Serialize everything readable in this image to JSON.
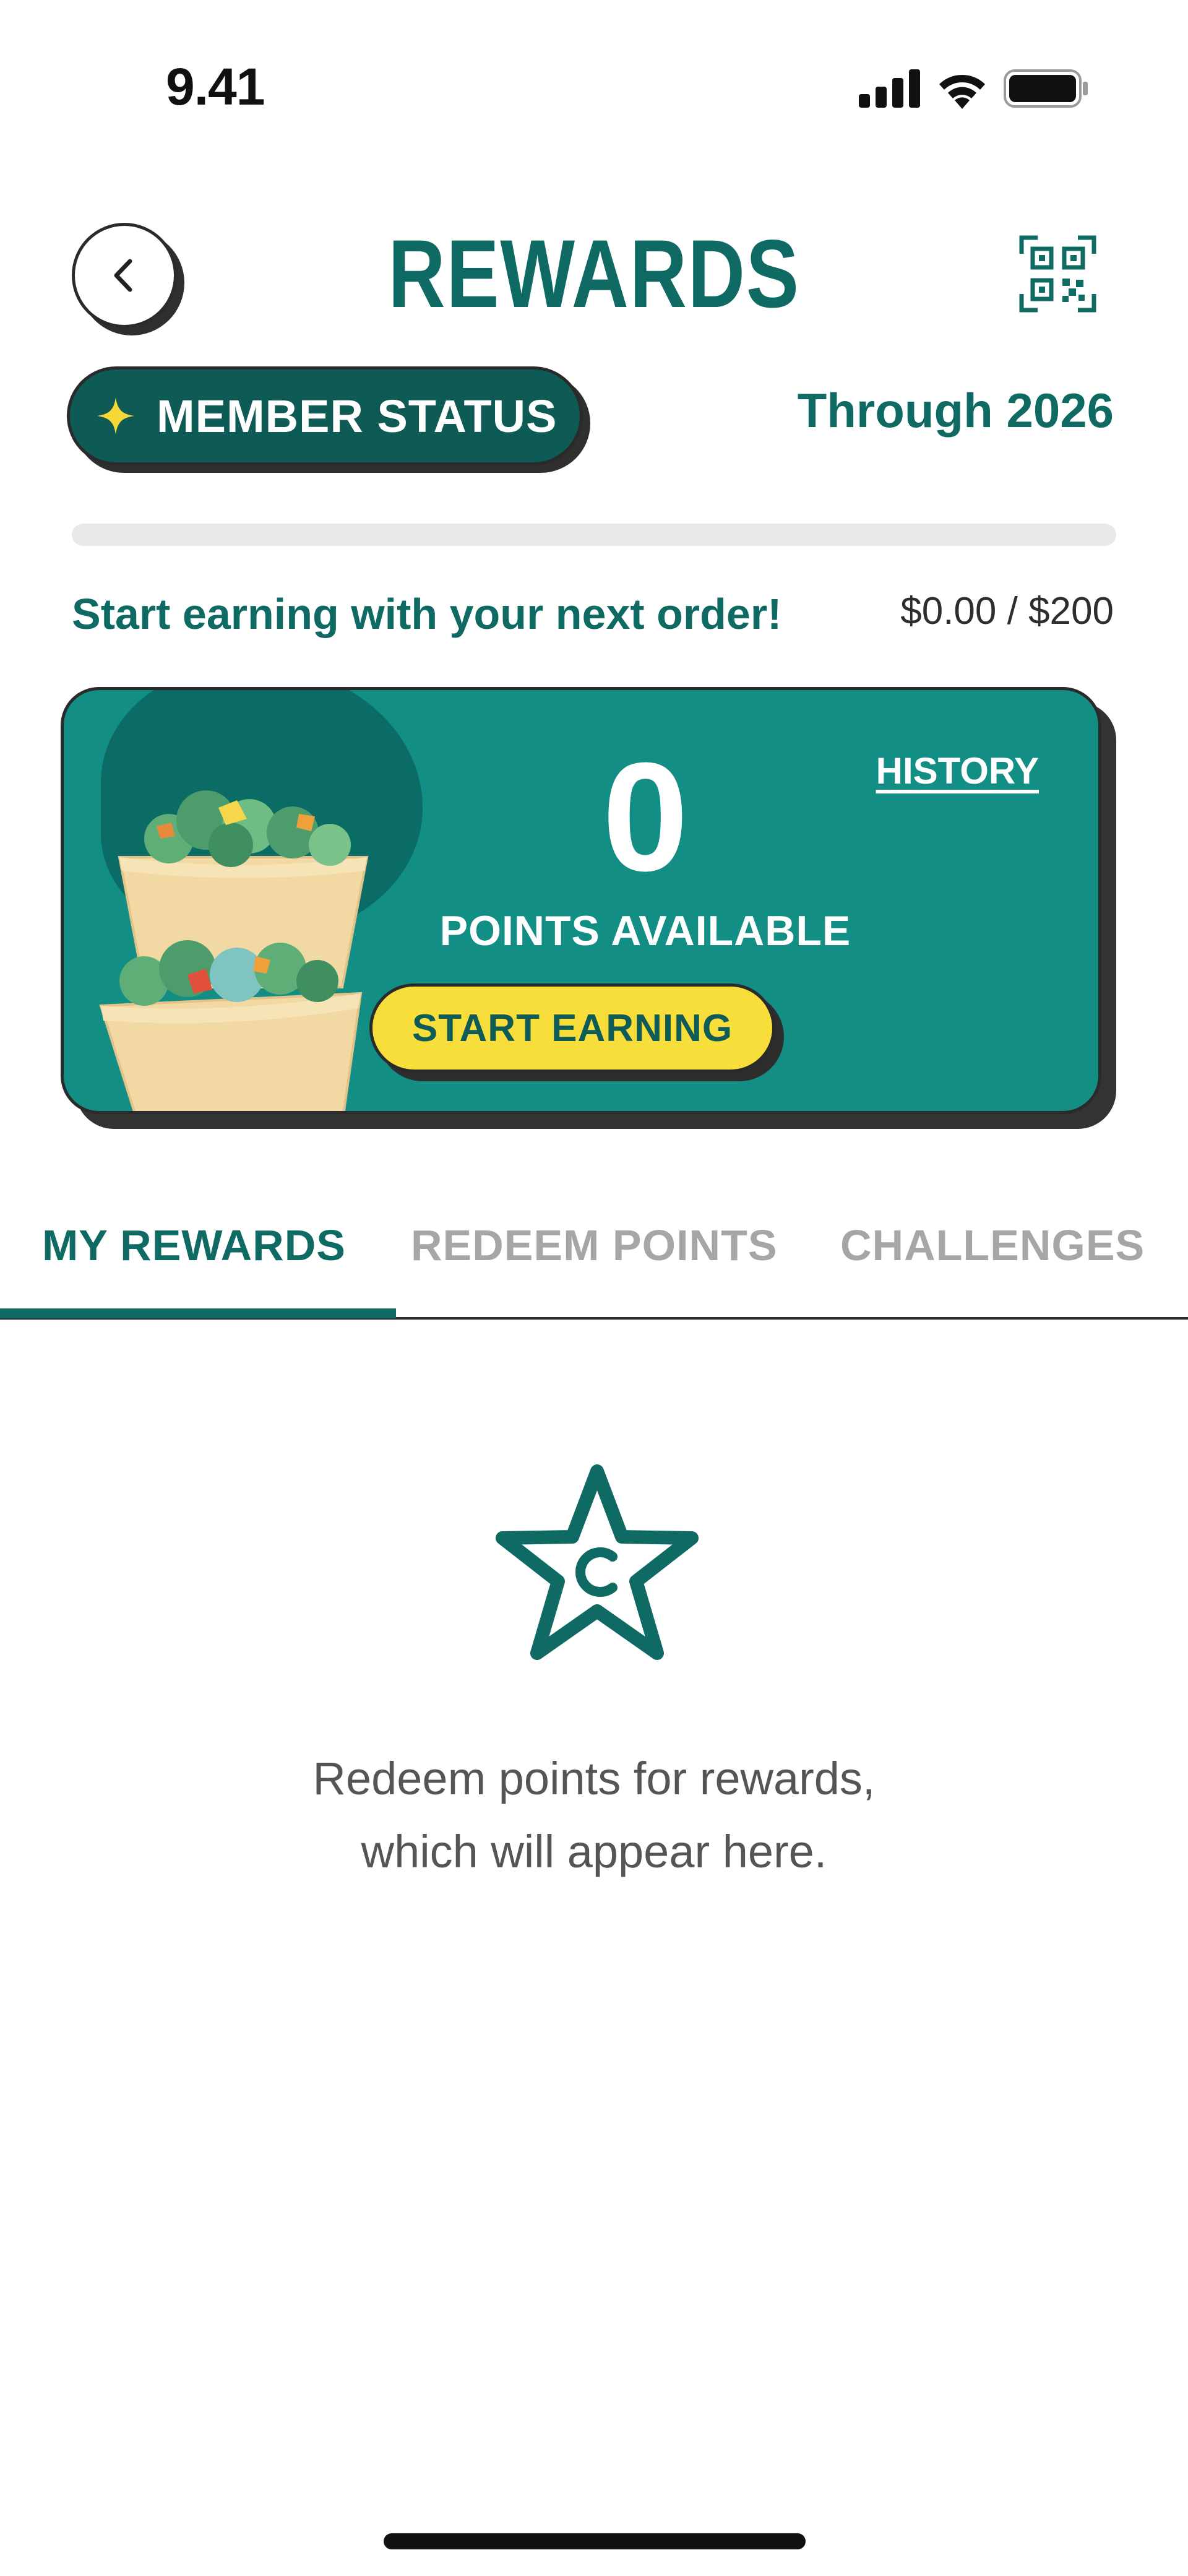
{
  "status_bar": {
    "time": "9.41",
    "icons": [
      "cellular-signal-icon",
      "wifi-icon",
      "battery-icon"
    ]
  },
  "header": {
    "title": "REWARDS",
    "back_icon": "chevron-left-icon",
    "qr_icon": "qr-code-icon"
  },
  "membership": {
    "status_label": "MEMBER STATUS",
    "status_icon": "sparkle-icon",
    "through_label": "Through 2026",
    "progress_fraction": 0,
    "message": "Start earning with your next order!",
    "amount": "$0.00 / $200"
  },
  "points_card": {
    "points": "0",
    "points_label": "POINTS AVAILABLE",
    "history_label": "HISTORY",
    "start_button_label": "START EARNING"
  },
  "tabs": [
    {
      "label": "MY REWARDS",
      "active": true
    },
    {
      "label": "REDEEM POINTS",
      "active": false
    },
    {
      "label": "CHALLENGES",
      "active": false
    }
  ],
  "empty_state": {
    "icon": "rewards-star-icon",
    "line1": "Redeem points for rewards,",
    "line2": "which will appear here."
  },
  "colors": {
    "brand_teal": "#0f6a64",
    "card_teal": "#138e84",
    "button_yellow": "#f7de3a"
  }
}
